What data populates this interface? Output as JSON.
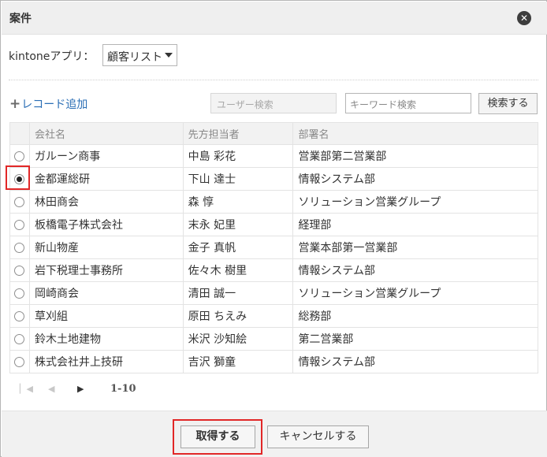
{
  "dialog": {
    "title": "案件",
    "close_icon": "close-icon"
  },
  "app_selector": {
    "label": "kintoneアプリ：",
    "selected": "顧客リスト"
  },
  "toolbar": {
    "add_record_label": "レコード追加",
    "user_search_placeholder": "ユーザー検索",
    "keyword_search_placeholder": "キーワード検索",
    "search_button": "検索する"
  },
  "table": {
    "headers": [
      "会社名",
      "先方担当者",
      "部署名"
    ],
    "rows": [
      {
        "company": "ガルーン商事",
        "contact": "中島 彩花",
        "department": "営業部第二営業部",
        "selected": false
      },
      {
        "company": "金都運総研",
        "contact": "下山 達士",
        "department": "情報システム部",
        "selected": true
      },
      {
        "company": "林田商会",
        "contact": "森 惇",
        "department": "ソリューション営業グループ",
        "selected": false
      },
      {
        "company": "板橋電子株式会社",
        "contact": "末永 妃里",
        "department": "経理部",
        "selected": false
      },
      {
        "company": "新山物産",
        "contact": "金子 真帆",
        "department": "営業本部第一営業部",
        "selected": false
      },
      {
        "company": "岩下税理士事務所",
        "contact": "佐々木 樹里",
        "department": "情報システム部",
        "selected": false
      },
      {
        "company": "岡崎商会",
        "contact": "清田 誠一",
        "department": "ソリューション営業グループ",
        "selected": false
      },
      {
        "company": "草刈組",
        "contact": "原田 ちえみ",
        "department": "総務部",
        "selected": false
      },
      {
        "company": "鈴木土地建物",
        "contact": "米沢 沙知絵",
        "department": "第二営業部",
        "selected": false
      },
      {
        "company": "株式会社井上技研",
        "contact": "吉沢 獅童",
        "department": "情報システム部",
        "selected": false
      }
    ]
  },
  "pager": {
    "range": "1-10"
  },
  "footer": {
    "ok_button": "取得する",
    "cancel_button": "キャンセルする"
  },
  "colors": {
    "highlight": "#e12727",
    "link": "#2a6eb5"
  }
}
